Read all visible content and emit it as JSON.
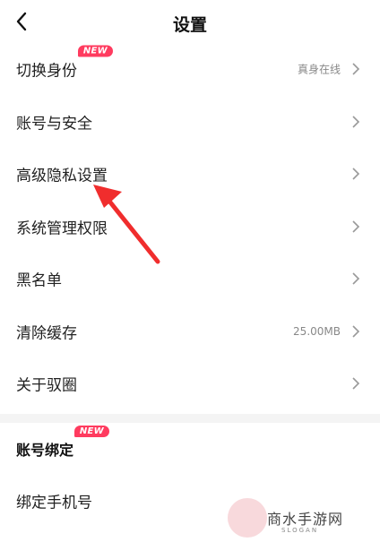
{
  "header": {
    "title": "设置"
  },
  "settings": [
    {
      "label": "切换身份",
      "badge": "NEW",
      "value": "真身在线"
    },
    {
      "label": "账号与安全"
    },
    {
      "label": "高级隐私设置"
    },
    {
      "label": "系统管理权限"
    },
    {
      "label": "黑名单"
    },
    {
      "label": "清除缓存",
      "value": "25.00MB"
    },
    {
      "label": "关于驭圈"
    }
  ],
  "binding": {
    "title": "账号绑定",
    "badge": "NEW",
    "items": [
      {
        "label": "绑定手机号"
      }
    ]
  },
  "watermark": {
    "text": "商水手游网",
    "sub": "SLOGAN"
  },
  "colors": {
    "accent": "#ff3b5f",
    "arrow": "#f02d2d"
  }
}
